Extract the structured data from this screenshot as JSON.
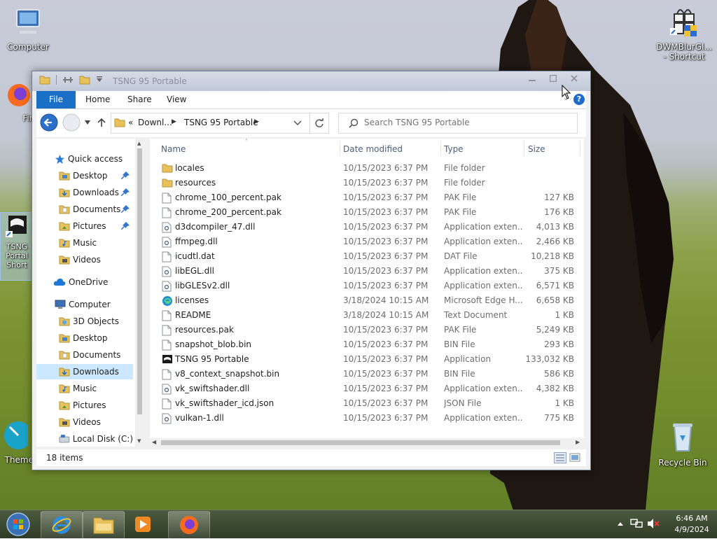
{
  "desktop": {
    "icons": {
      "computer": "Computer",
      "firefox": "Firef",
      "tsng_line1": "TSNG",
      "tsng_line2": "Portal",
      "tsng_line3": "Short",
      "theme": "Theme",
      "dwm_line1": "DWMBlurGl...",
      "dwm_line2": "- Shortcut",
      "recycle": "Recycle Bin"
    }
  },
  "window": {
    "title": "TSNG 95 Portable",
    "ribbon_tabs": [
      "File",
      "Home",
      "Share",
      "View"
    ],
    "help_label": "?",
    "breadcrumb": {
      "overflow": "«",
      "parts": [
        "Downl...",
        "TSNG 95 Portable"
      ]
    },
    "search_placeholder": "Search TSNG 95 Portable",
    "columns": {
      "name": "Name",
      "date": "Date modified",
      "type": "Type",
      "size": "Size"
    },
    "nav": {
      "quick_access": "Quick access",
      "qa_items": [
        "Desktop",
        "Downloads",
        "Documents",
        "Pictures",
        "Music",
        "Videos"
      ],
      "onedrive": "OneDrive",
      "computer": "Computer",
      "computer_items": [
        "3D Objects",
        "Desktop",
        "Documents",
        "Downloads",
        "Music",
        "Pictures",
        "Videos",
        "Local Disk (C:)"
      ]
    },
    "files": [
      {
        "name": "locales",
        "date": "10/15/2023 6:37 PM",
        "type": "File folder",
        "size": "",
        "icon": "folder-icon"
      },
      {
        "name": "resources",
        "date": "10/15/2023 6:37 PM",
        "type": "File folder",
        "size": "",
        "icon": "folder-icon"
      },
      {
        "name": "chrome_100_percent.pak",
        "date": "10/15/2023 6:37 PM",
        "type": "PAK File",
        "size": "127 KB",
        "icon": "file-icon"
      },
      {
        "name": "chrome_200_percent.pak",
        "date": "10/15/2023 6:37 PM",
        "type": "PAK File",
        "size": "176 KB",
        "icon": "file-icon"
      },
      {
        "name": "d3dcompiler_47.dll",
        "date": "10/15/2023 6:37 PM",
        "type": "Application exten...",
        "size": "4,013 KB",
        "icon": "dll-icon"
      },
      {
        "name": "ffmpeg.dll",
        "date": "10/15/2023 6:37 PM",
        "type": "Application exten...",
        "size": "2,466 KB",
        "icon": "dll-icon"
      },
      {
        "name": "icudtl.dat",
        "date": "10/15/2023 6:37 PM",
        "type": "DAT File",
        "size": "10,218 KB",
        "icon": "file-icon"
      },
      {
        "name": "libEGL.dll",
        "date": "10/15/2023 6:37 PM",
        "type": "Application exten...",
        "size": "375 KB",
        "icon": "dll-icon"
      },
      {
        "name": "libGLESv2.dll",
        "date": "10/15/2023 6:37 PM",
        "type": "Application exten...",
        "size": "6,571 KB",
        "icon": "dll-icon"
      },
      {
        "name": "licenses",
        "date": "3/18/2024 10:15 AM",
        "type": "Microsoft Edge H...",
        "size": "6,658 KB",
        "icon": "edge-icon"
      },
      {
        "name": "README",
        "date": "3/18/2024 10:15 AM",
        "type": "Text Document",
        "size": "1 KB",
        "icon": "file-icon"
      },
      {
        "name": "resources.pak",
        "date": "10/15/2023 6:37 PM",
        "type": "PAK File",
        "size": "5,249 KB",
        "icon": "file-icon"
      },
      {
        "name": "snapshot_blob.bin",
        "date": "10/15/2023 6:37 PM",
        "type": "BIN File",
        "size": "293 KB",
        "icon": "file-icon"
      },
      {
        "name": "TSNG 95 Portable",
        "date": "10/15/2023 6:37 PM",
        "type": "Application",
        "size": "133,032 KB",
        "icon": "app-icon"
      },
      {
        "name": "v8_context_snapshot.bin",
        "date": "10/15/2023 6:37 PM",
        "type": "BIN File",
        "size": "586 KB",
        "icon": "file-icon"
      },
      {
        "name": "vk_swiftshader.dll",
        "date": "10/15/2023 6:37 PM",
        "type": "Application exten...",
        "size": "4,382 KB",
        "icon": "dll-icon"
      },
      {
        "name": "vk_swiftshader_icd.json",
        "date": "10/15/2023 6:37 PM",
        "type": "JSON File",
        "size": "1 KB",
        "icon": "file-icon"
      },
      {
        "name": "vulkan-1.dll",
        "date": "10/15/2023 6:37 PM",
        "type": "Application exten...",
        "size": "775 KB",
        "icon": "dll-icon"
      }
    ],
    "status": "18 items"
  },
  "taskbar": {
    "time": "6:46 AM",
    "date": "4/9/2024"
  },
  "colors": {
    "ribbon_file": "#1a6fc6",
    "selected_nav": "#cce8ff",
    "header_text": "#4c607a"
  }
}
